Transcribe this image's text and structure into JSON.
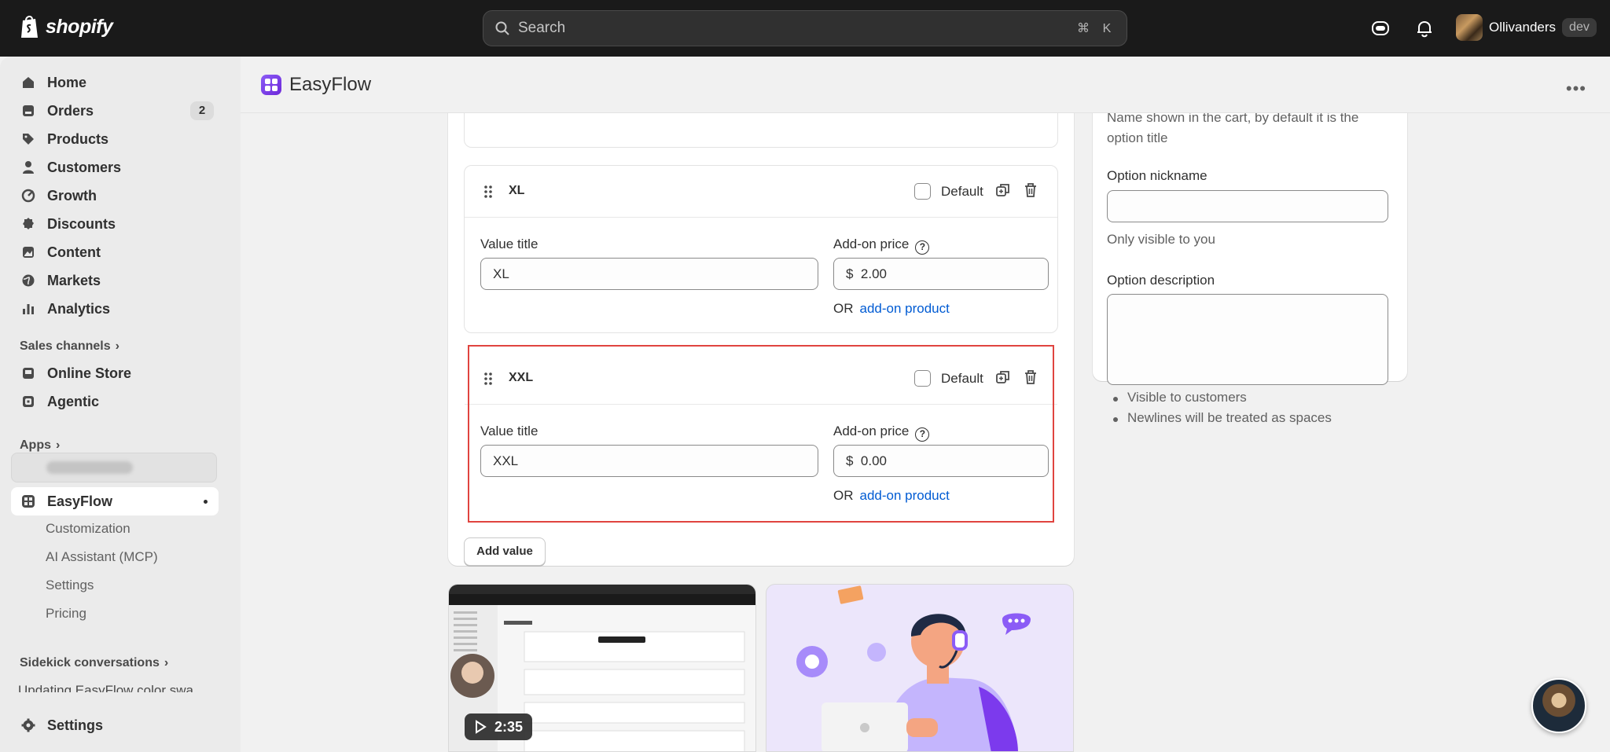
{
  "topbar": {
    "brand": "shopify",
    "search_placeholder": "Search",
    "shortcut_cmd": "⌘",
    "shortcut_key": "K",
    "store_name": "Ollivanders",
    "store_badge": "dev"
  },
  "sidebar": {
    "items": [
      {
        "label": "Home",
        "icon": "home-icon"
      },
      {
        "label": "Orders",
        "icon": "orders-icon",
        "count": "2"
      },
      {
        "label": "Products",
        "icon": "tag-icon"
      },
      {
        "label": "Customers",
        "icon": "person-icon"
      },
      {
        "label": "Growth",
        "icon": "growth-icon"
      },
      {
        "label": "Discounts",
        "icon": "discount-icon"
      },
      {
        "label": "Content",
        "icon": "content-icon"
      },
      {
        "label": "Markets",
        "icon": "globe-icon"
      },
      {
        "label": "Analytics",
        "icon": "chart-icon"
      }
    ],
    "sales_channels_label": "Sales channels",
    "channels": [
      {
        "label": "Online Store",
        "icon": "store-icon"
      },
      {
        "label": "Agentic",
        "icon": "agentic-icon"
      }
    ],
    "apps_label": "Apps",
    "blurred_app": "StoreFAQ dev",
    "active_app": "EasyFlow",
    "app_subitems": [
      "Customization",
      "AI Assistant (MCP)",
      "Settings",
      "Pricing"
    ],
    "sidekick_label": "Sidekick conversations",
    "sidekick_item": "Updating EasyFlow color swa...",
    "settings_label": "Settings"
  },
  "app": {
    "title": "EasyFlow"
  },
  "values": [
    {
      "name": "XL",
      "default_label": "Default",
      "value_title_label": "Value title",
      "value_title": "XL",
      "price_label": "Add-on price",
      "currency": "$",
      "price": "2.00",
      "or_text": "OR",
      "addon_link": "add-on product"
    },
    {
      "name": "XXL",
      "default_label": "Default",
      "value_title_label": "Value title",
      "value_title": "XXL",
      "price_label": "Add-on price",
      "currency": "$",
      "price": "0.00",
      "or_text": "OR",
      "addon_link": "add-on product"
    }
  ],
  "add_value_label": "Add value",
  "side_panel": {
    "cart_name_help": "Name shown in the cart, by default it is the option title",
    "nickname_label": "Option nickname",
    "nickname_help": "Only visible to you",
    "description_label": "Option description",
    "bullets": [
      "Visible to customers",
      "Newlines will be treated as spaces"
    ]
  },
  "video": {
    "duration": "2:35"
  },
  "colors": {
    "topbar": "#1a1a1a",
    "link": "#005bd3",
    "selection": "#e0443f",
    "accent": "#8b5cf6"
  }
}
